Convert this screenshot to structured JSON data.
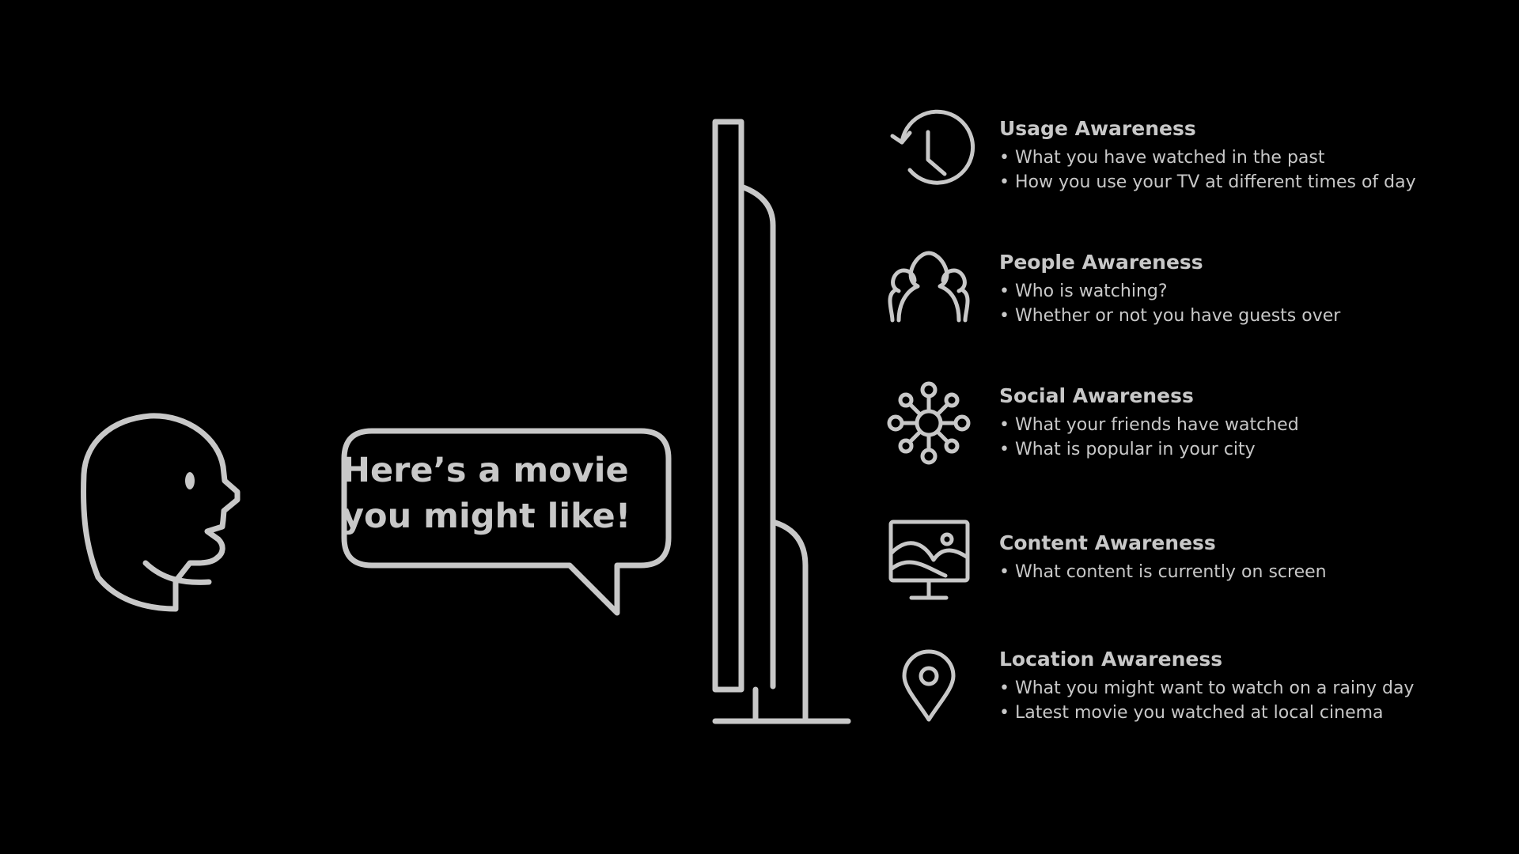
{
  "colors": {
    "background": "#000000",
    "stroke": "#c8c8c8"
  },
  "bubble": {
    "line1": "Here’s a movie",
    "line2": "you might like!"
  },
  "awareness": [
    {
      "icon": "clock-history-icon",
      "title": "Usage Awareness",
      "points": [
        "What you have watched in the past",
        "How you use your TV at different times of day"
      ]
    },
    {
      "icon": "people-icon",
      "title": "People Awareness",
      "points": [
        "Who is watching?",
        "Whether or not you have guests over"
      ]
    },
    {
      "icon": "network-icon",
      "title": "Social Awareness",
      "points": [
        "What your friends have watched",
        "What is popular in your city"
      ]
    },
    {
      "icon": "monitor-image-icon",
      "title": "Content Awareness",
      "points": [
        "What content is currently on screen"
      ]
    },
    {
      "icon": "location-pin-icon",
      "title": "Location Awareness",
      "points": [
        "What you might want to watch on a rainy day",
        "Latest movie you watched at local cinema"
      ]
    }
  ]
}
